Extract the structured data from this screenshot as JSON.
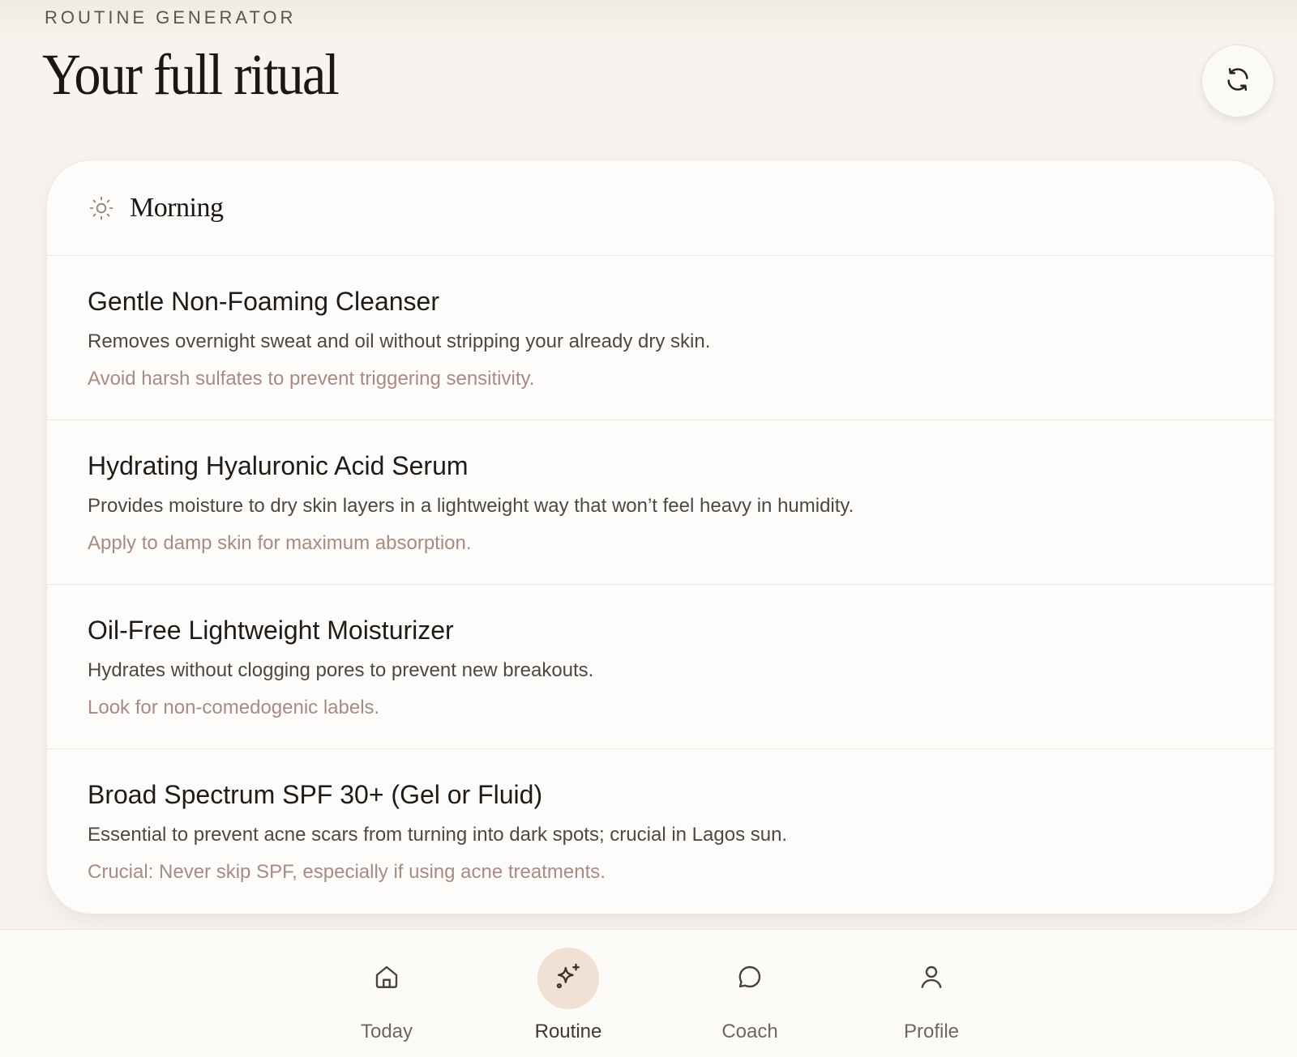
{
  "header": {
    "eyebrow": "ROUTINE GENERATOR",
    "title": "Your full ritual",
    "refresh_icon": "refresh-icon"
  },
  "section": {
    "icon": "sun-icon",
    "title": "Morning",
    "steps": [
      {
        "name": "Gentle Non-Foaming Cleanser",
        "description": "Removes overnight sweat and oil without stripping your already dry skin.",
        "tip": "Avoid harsh sulfates to prevent triggering sensitivity."
      },
      {
        "name": "Hydrating Hyaluronic Acid Serum",
        "description": "Provides moisture to dry skin layers in a lightweight way that won’t feel heavy in humidity.",
        "tip": "Apply to damp skin for maximum absorption."
      },
      {
        "name": "Oil-Free Lightweight Moisturizer",
        "description": "Hydrates without clogging pores to prevent new breakouts.",
        "tip": "Look for non-comedogenic labels."
      },
      {
        "name": "Broad Spectrum SPF 30+ (Gel or Fluid)",
        "description": "Essential to prevent acne scars from turning into dark spots; crucial in Lagos sun.",
        "tip": "Crucial: Never skip SPF, especially if using acne treatments."
      }
    ]
  },
  "nav": {
    "items": [
      {
        "label": "Today",
        "icon": "home-icon",
        "active": false
      },
      {
        "label": "Routine",
        "icon": "sparkle-icon",
        "active": true
      },
      {
        "label": "Coach",
        "icon": "chat-bubble-icon",
        "active": false
      },
      {
        "label": "Profile",
        "icon": "user-icon",
        "active": false
      }
    ]
  },
  "colors": {
    "background": "#f7f4ef",
    "tip_text": "#a88b83",
    "active_nav_bg": "#f0e1d4"
  }
}
